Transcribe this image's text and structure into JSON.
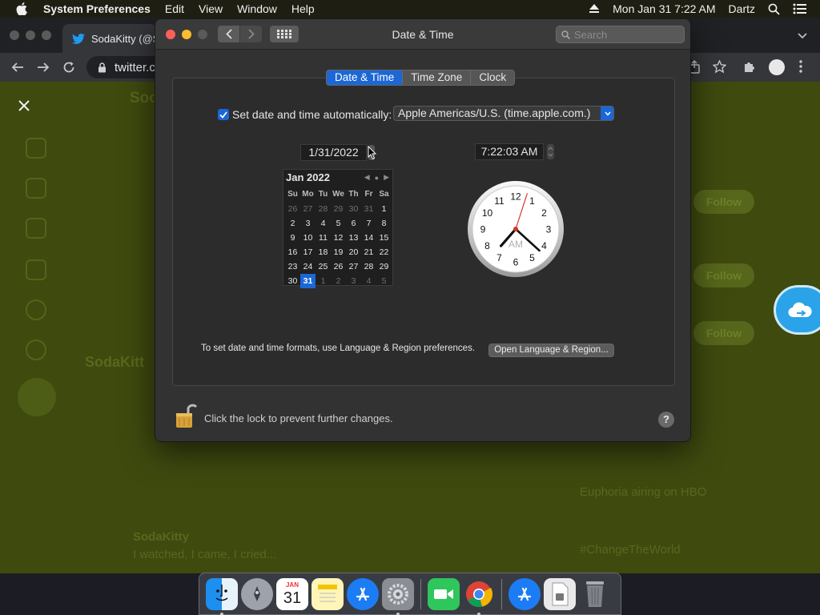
{
  "menubar": {
    "app_name": "System Preferences",
    "items": [
      "Edit",
      "View",
      "Window",
      "Help"
    ],
    "datetime": "Mon Jan 31  7:22 AM",
    "user": "Dartz"
  },
  "browser": {
    "tab_title": "SodaKitty (@S",
    "url": "twitter.c",
    "page_texts": [
      "Soda",
      "SodaKitt",
      "Euphoria airing on HBO",
      "#ChangeTheWorld",
      "SodaKitty",
      "I watched, I came, I cried...",
      "Follow"
    ]
  },
  "window": {
    "title": "Date & Time",
    "search_placeholder": "Search",
    "tabs": [
      "Date & Time",
      "Time Zone",
      "Clock"
    ],
    "active_tab": "Date & Time",
    "auto_label": "Set date and time automatically:",
    "auto_checked": true,
    "time_server": "Apple Americas/U.S. (time.apple.com.)",
    "date_value": "1/31/2022",
    "time_value": "7:22:03 AM",
    "calendar": {
      "month_label": "Jan 2022",
      "weekdays": [
        "Su",
        "Mo",
        "Tu",
        "We",
        "Th",
        "Fr",
        "Sa"
      ],
      "weeks": [
        [
          "26",
          "27",
          "28",
          "29",
          "30",
          "31",
          "1"
        ],
        [
          "2",
          "3",
          "4",
          "5",
          "6",
          "7",
          "8"
        ],
        [
          "9",
          "10",
          "11",
          "12",
          "13",
          "14",
          "15"
        ],
        [
          "16",
          "17",
          "18",
          "19",
          "20",
          "21",
          "22"
        ],
        [
          "23",
          "24",
          "25",
          "26",
          "27",
          "28",
          "29"
        ],
        [
          "30",
          "31",
          "1",
          "2",
          "3",
          "4",
          "5"
        ]
      ],
      "selected_day": "31"
    },
    "clock": {
      "numbers": [
        "12",
        "1",
        "2",
        "3",
        "4",
        "5",
        "6",
        "7",
        "8",
        "9",
        "10",
        "11"
      ],
      "meridiem": "AM",
      "hour": 7,
      "minute": 22,
      "second": 3
    },
    "formats_text": "To set date and time formats, use Language & Region preferences.",
    "open_lang_button": "Open Language & Region...",
    "lock_text": "Click the lock to prevent further changes.",
    "help_label": "?"
  },
  "colors": {
    "accent": "#1b67d6",
    "desktop_green": "#3f4a0f"
  },
  "dock": {
    "calendar_month": "JAN",
    "calendar_day": "31"
  }
}
